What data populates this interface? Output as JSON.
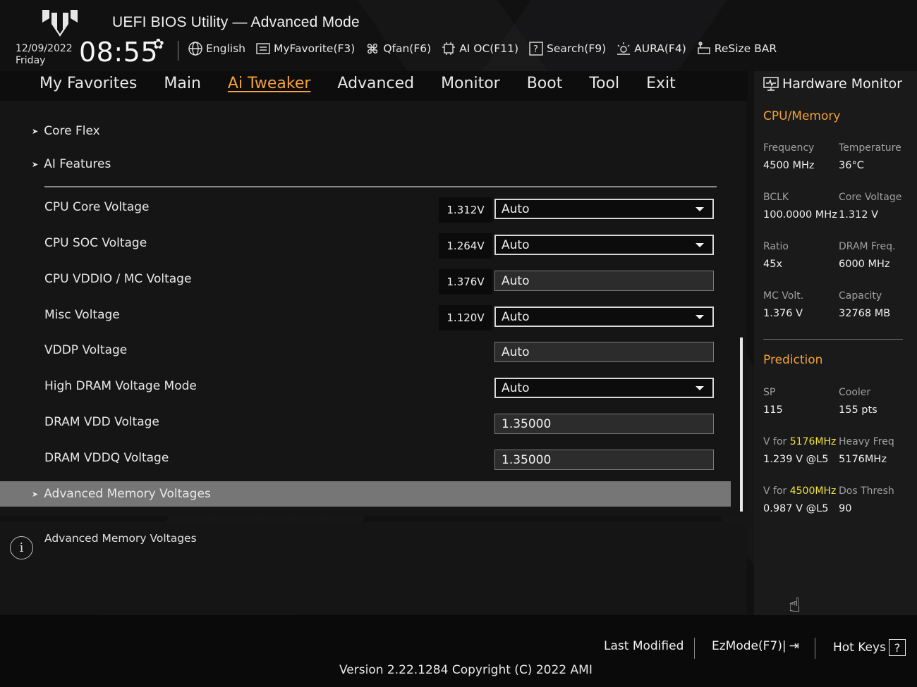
{
  "header": {
    "title": "UEFI BIOS Utility — Advanced Mode",
    "date": "12/09/2022",
    "day": "Friday",
    "time": "08:55",
    "toolbar": [
      {
        "label": "English",
        "icon": "globe-icon"
      },
      {
        "label": "MyFavorite(F3)",
        "icon": "favorite-icon"
      },
      {
        "label": "Qfan(F6)",
        "icon": "fan-icon"
      },
      {
        "label": "AI OC(F11)",
        "icon": "ai-oc-icon"
      },
      {
        "label": "Search(F9)",
        "icon": "search-icon"
      },
      {
        "label": "AURA(F4)",
        "icon": "aura-icon"
      },
      {
        "label": "ReSize BAR",
        "icon": "resize-bar-icon"
      }
    ]
  },
  "tabs": [
    "My Favorites",
    "Main",
    "Ai Tweaker",
    "Advanced",
    "Monitor",
    "Boot",
    "Tool",
    "Exit"
  ],
  "active_tab": "Ai Tweaker",
  "submenus": {
    "core_flex": "Core Flex",
    "ai_features": "AI Features",
    "advanced_memory": "Advanced Memory Voltages"
  },
  "settings": [
    {
      "label": "CPU Core Voltage",
      "current": "1.312V",
      "value": "Auto",
      "type": "dropdown"
    },
    {
      "label": "CPU SOC Voltage",
      "current": "1.264V",
      "value": "Auto",
      "type": "dropdown"
    },
    {
      "label": "CPU VDDIO / MC Voltage",
      "current": "1.376V",
      "value": "Auto",
      "type": "field"
    },
    {
      "label": "Misc Voltage",
      "current": "1.120V",
      "value": "Auto",
      "type": "dropdown"
    },
    {
      "label": "VDDP Voltage",
      "current": "",
      "value": "Auto",
      "type": "field"
    },
    {
      "label": "High DRAM Voltage Mode",
      "current": "",
      "value": "Auto",
      "type": "dropdown"
    },
    {
      "label": "DRAM VDD Voltage",
      "current": "",
      "value": "1.35000",
      "type": "field"
    },
    {
      "label": "DRAM VDDQ Voltage",
      "current": "",
      "value": "1.35000",
      "type": "field"
    }
  ],
  "info_text": "Advanced Memory Voltages",
  "hardware_monitor": {
    "title": "Hardware Monitor",
    "cpu_memory_heading": "CPU/Memory",
    "frequency_label": "Frequency",
    "frequency": "4500 MHz",
    "temperature_label": "Temperature",
    "temperature": "36°C",
    "bclk_label": "BCLK",
    "bclk": "100.0000 MHz",
    "core_voltage_label": "Core Voltage",
    "core_voltage": "1.312 V",
    "ratio_label": "Ratio",
    "ratio": "45x",
    "dram_freq_label": "DRAM Freq.",
    "dram_freq": "6000 MHz",
    "mc_volt_label": "MC Volt.",
    "mc_volt": "1.376 V",
    "capacity_label": "Capacity",
    "capacity": "32768 MB",
    "prediction_heading": "Prediction",
    "sp_label": "SP",
    "sp": "115",
    "cooler_label": "Cooler",
    "cooler": "155 pts",
    "v_for_label": "V for",
    "v_for_freq1": "5176MHz",
    "v_for_val1": "1.239 V @L5",
    "heavy_freq_label": "Heavy Freq",
    "heavy_freq": "5176MHz",
    "v_for_freq2": "4500MHz",
    "v_for_val2": "0.987 V @L5",
    "dos_thresh_label": "Dos Thresh",
    "dos_thresh": "90"
  },
  "footer": {
    "last_modified": "Last Modified",
    "ezmode": "EzMode(F7)|",
    "hotkeys": "Hot Keys",
    "version": "Version 2.22.1284 Copyright (C) 2022 AMI"
  },
  "colors": {
    "accent": "#f3a138",
    "highlight": "#f1e33b"
  }
}
